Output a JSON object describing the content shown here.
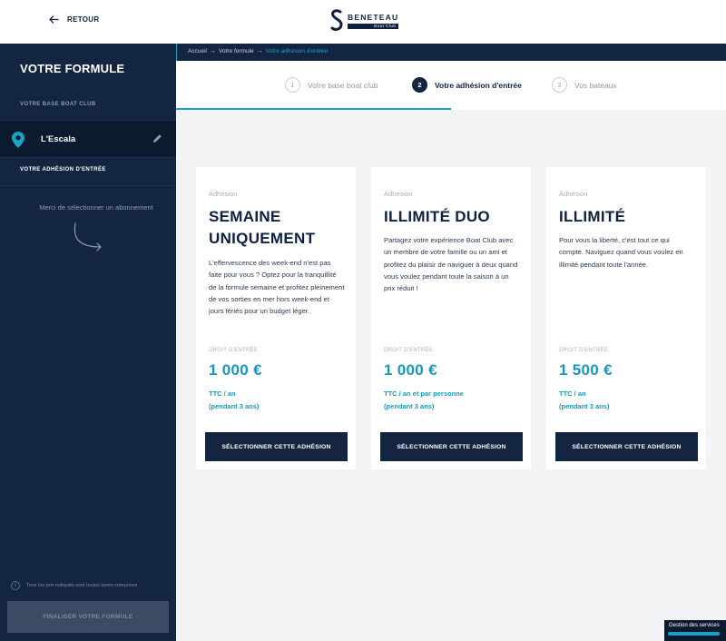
{
  "header": {
    "back_label": "RETOUR",
    "logo_name": "BENETEAU",
    "logo_sub": "Boat Club"
  },
  "sidebar": {
    "title": "VOTRE FORMULE",
    "base_section": "VOTRE BASE BOAT CLUB",
    "location": "L'Escala",
    "adhesion_section": "VOTRE ADHÉSION D'ENTRÉE",
    "empty_message": "Merci de sélectionner un abonnement",
    "info_text": "Tous les prix indiqués sont toutes taxes comprises",
    "finalize_label": "FINALISER VOTRE FORMULE"
  },
  "breadcrumb": {
    "items": [
      "Accueil",
      "Votre formule",
      "Votre adhésion d'entrée"
    ],
    "separator": "→"
  },
  "steps": [
    {
      "num": "1",
      "label": "Votre base boat club",
      "active": false
    },
    {
      "num": "2",
      "label": "Votre adhésion d'entrée",
      "active": true
    },
    {
      "num": "3",
      "label": "Vos bateaux",
      "active": false
    }
  ],
  "cards": [
    {
      "tag": "Adhésion",
      "title": "SEMAINE UNIQUEMENT",
      "description": "L'effervescence des week-end n'est pas faite pour vous ? Optez pour la tranquillité de la formule semaine et profitez pleinement de vos sorties en mer hors week-end et jours fériés pour un budget léger.",
      "price_label": "DROIT D'ENTRÉE",
      "price": "1 000 €",
      "note_line1": "TTC / an",
      "note_line2": "(pendant 3 ans)",
      "button": "SÉLECTIONNER CETTE ADHÉSION"
    },
    {
      "tag": "Adhésion",
      "title": "ILLIMITÉ DUO",
      "description": "Partagez votre expérience Boat Club avec un membre de votre famille ou un ami et profitez du plaisir de naviguer à deux quand vous voulez pendant toute la saison à un prix réduit !",
      "price_label": "DROIT D'ENTRÉE",
      "price": "1 000 €",
      "note_line1": "TTC / an et par personne",
      "note_line2": "(pendant 3 ans)",
      "button": "SÉLECTIONNER CETTE ADHÉSION"
    },
    {
      "tag": "Adhésion",
      "title": "ILLIMITÉ",
      "description": "Pour vous la liberté, c'est tout ce qui compte. Naviguez quand vous voulez en illimité pendant toute l'année.",
      "price_label": "DROIT D'ENTRÉE",
      "price": "1 500 €",
      "note_line1": "TTC / an",
      "note_line2": "(pendant 3 ans)",
      "button": "SÉLECTIONNER CETTE ADHÉSION"
    }
  ],
  "services": {
    "label": "Gestion des services"
  },
  "colors": {
    "navy": "#132540",
    "accent": "#1697c0",
    "background": "#f2f3f5"
  }
}
